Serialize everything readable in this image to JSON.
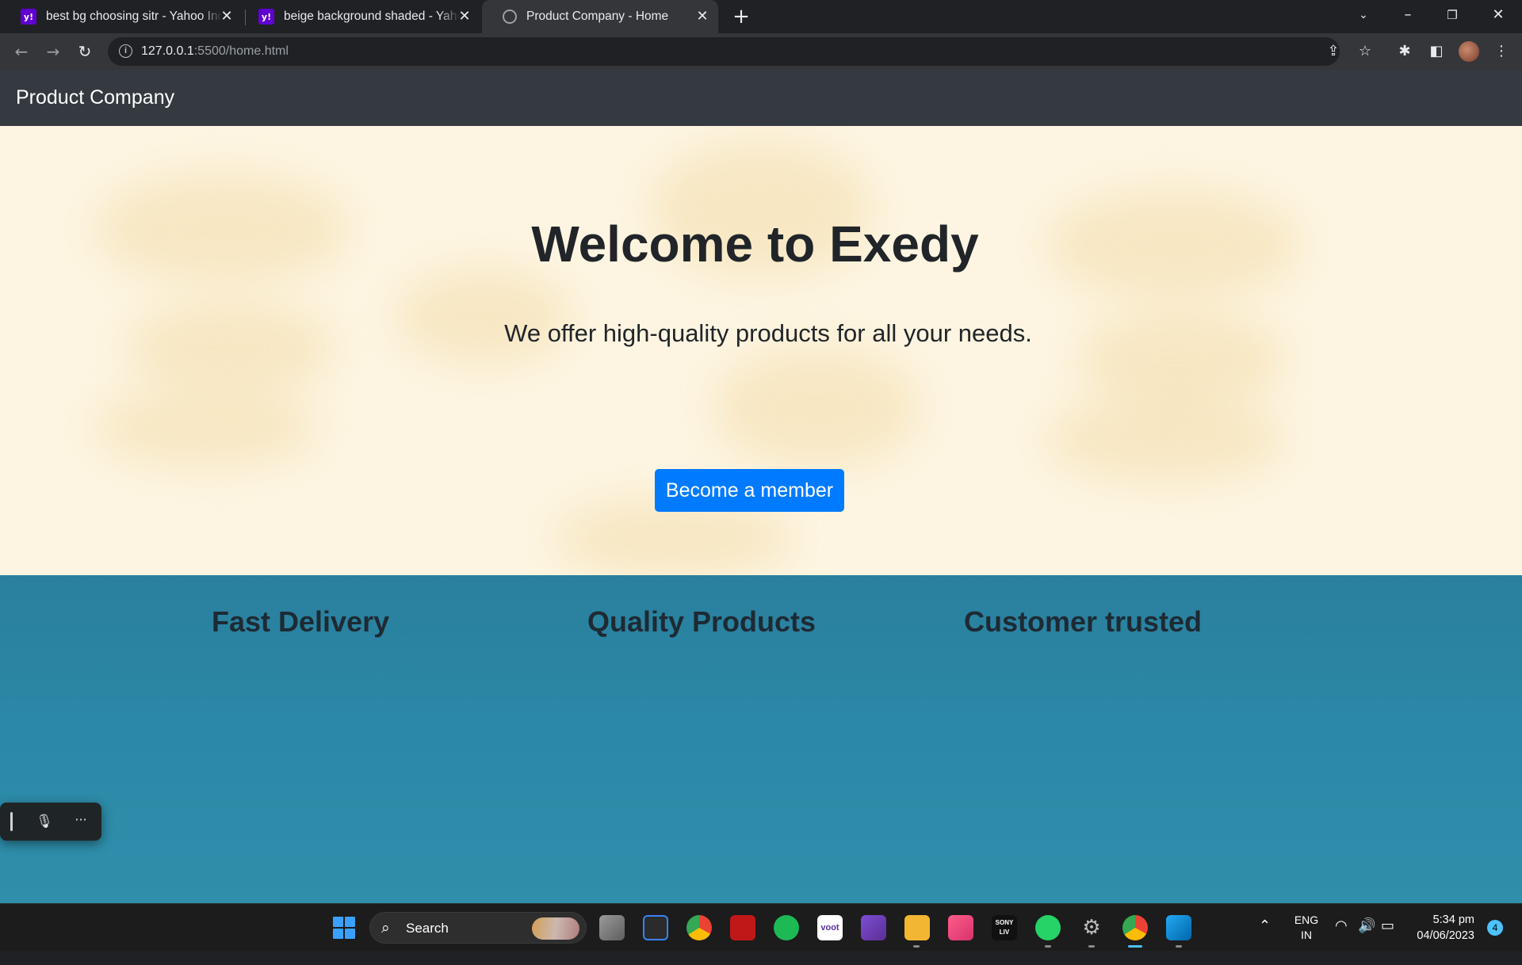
{
  "browser": {
    "tabs": [
      {
        "title": "best bg choosing sitr - Yahoo India Search",
        "favicon": "yahoo-icon",
        "active": false
      },
      {
        "title": "beige background shaded - Yahoo India Search",
        "favicon": "yahoo-icon",
        "active": false
      },
      {
        "title": "Product Company - Home",
        "favicon": "globe-icon",
        "active": true
      }
    ],
    "favicon_text": "y!",
    "url_host": "127.0.0.1",
    "url_rest": ":5500/home.html"
  },
  "page": {
    "brand": "Product Company",
    "hero": {
      "heading": "Welcome to Exedy",
      "subtitle": "We offer high-quality products for all your needs.",
      "cta_label": "Become a member"
    },
    "features": [
      "Fast Delivery",
      "Quality Products",
      "Customer trusted"
    ]
  },
  "taskbar": {
    "search_label": "Search",
    "apps": [
      "task-view-icon",
      "microsoft-store-icon",
      "chrome-icon",
      "mcafee-icon",
      "spotify-icon",
      "voot-icon",
      "visual-studio-icon",
      "file-explorer-icon",
      "clipchamp-icon",
      "sonyliv-icon",
      "whatsapp-icon",
      "settings-icon",
      "chrome-profile-icon",
      "vscode-icon"
    ],
    "voot_label": "voot",
    "sony_label": "SONY LIV",
    "lang_top": "ENG",
    "lang_bottom": "IN",
    "time": "5:34 pm",
    "date": "04/06/2023",
    "notification_count": "4"
  },
  "colors": {
    "navbar": "#343a40",
    "hero_bg": "#fdf5e1",
    "cta": "#007bff",
    "features_bg": "#2a89a8"
  }
}
